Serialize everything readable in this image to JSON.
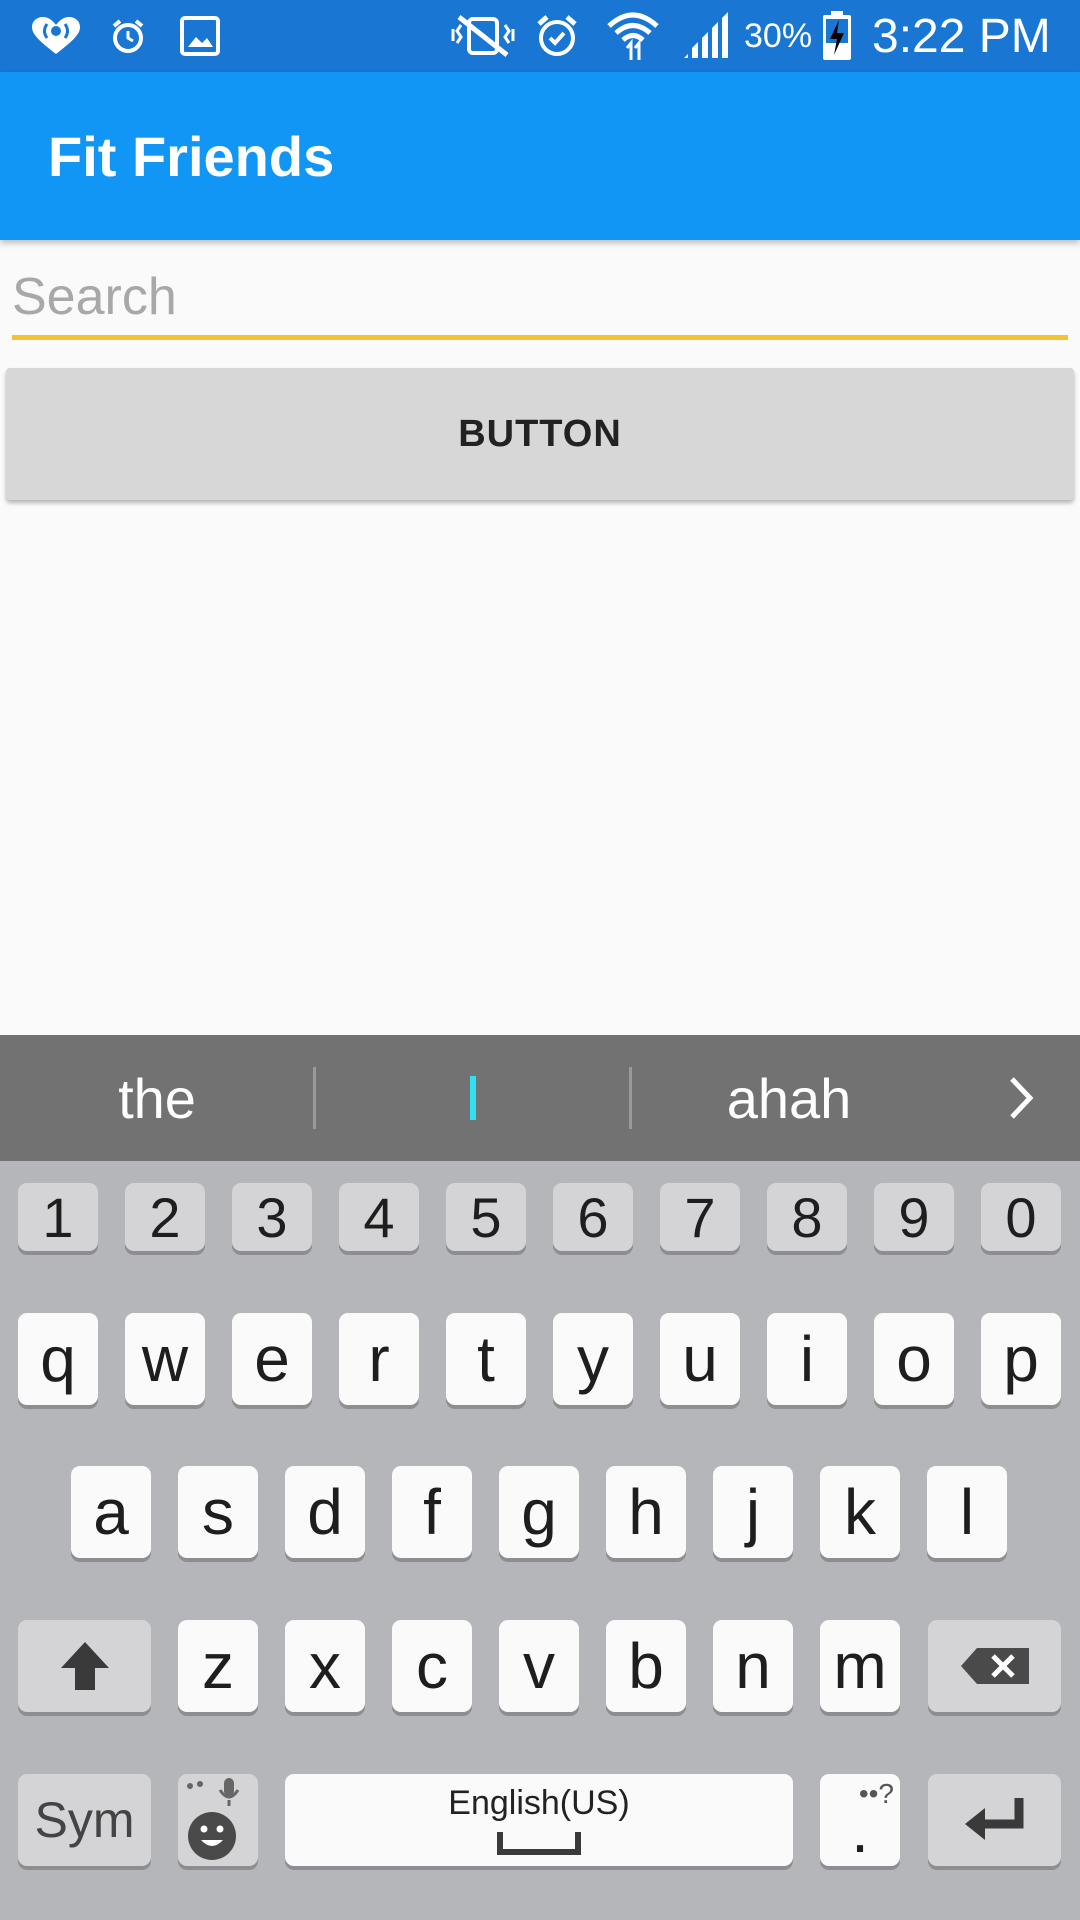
{
  "status_bar": {
    "battery_percent": "30%",
    "time": "3:22 PM",
    "icons": [
      "iheartradio-icon",
      "alarm-clock-icon",
      "gallery-icon",
      "vibrate-mute-icon",
      "alarm-icon",
      "wifi-icon",
      "signal-icon",
      "battery-charging-icon"
    ]
  },
  "app_bar": {
    "title": "Fit Friends"
  },
  "search": {
    "placeholder": "Search"
  },
  "main_button": {
    "label": "BUTTON"
  },
  "suggestions": {
    "left": "the",
    "right": "ahah"
  },
  "keyboard": {
    "numbers": [
      "1",
      "2",
      "3",
      "4",
      "5",
      "6",
      "7",
      "8",
      "9",
      "0"
    ],
    "row1": [
      "q",
      "w",
      "e",
      "r",
      "t",
      "y",
      "u",
      "i",
      "o",
      "p"
    ],
    "row2": [
      "a",
      "s",
      "d",
      "f",
      "g",
      "h",
      "j",
      "k",
      "l"
    ],
    "row3": [
      "z",
      "x",
      "c",
      "v",
      "b",
      "n",
      "m"
    ],
    "sym_label": "Sym",
    "space_label": "English(US)",
    "period_label": "."
  },
  "colors": {
    "status_bar": "#1976d2",
    "app_bar": "#1196f5",
    "search_underline": "#f4c430",
    "button": "#d7d7d7",
    "suggestion_bar": "#727272",
    "keyboard_bg": "#b5b6ba"
  }
}
